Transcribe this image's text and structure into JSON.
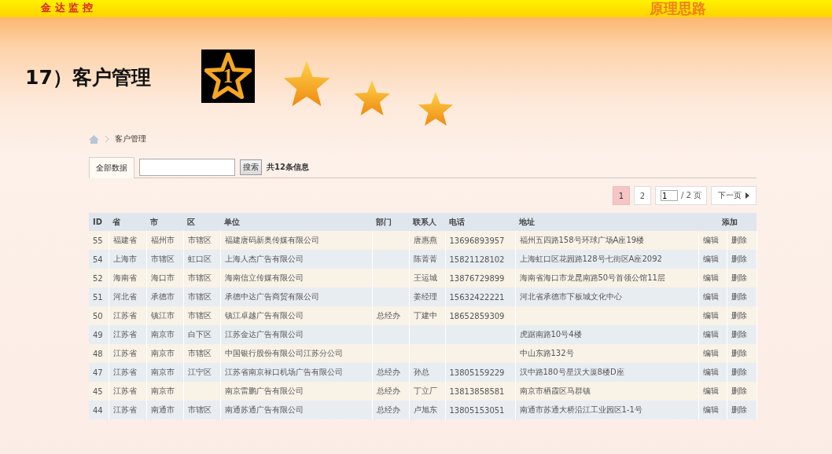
{
  "header": {
    "brand": "金 达 监 控",
    "section": "原理思路"
  },
  "slide_title": "17）客户管理",
  "badge": "1",
  "breadcrumb": "客户管理",
  "tabs": [
    {
      "label": "全部数据",
      "selected": true
    }
  ],
  "search": {
    "button": "搜索"
  },
  "count": "共12条信息",
  "pagination": {
    "pages": [
      {
        "label": "1",
        "selected": true
      },
      {
        "label": "2",
        "selected": false
      }
    ],
    "page_input": "1",
    "total": "/ 2 页",
    "next": "下一页"
  },
  "table": {
    "columns": [
      "ID",
      "省",
      "市",
      "区",
      "单位",
      "部门",
      "联系人",
      "电话",
      "地址",
      "添加"
    ],
    "rows": [
      {
        "cells": [
          "55",
          "福建省",
          "福州市",
          "市辖区",
          "福建唐码新奥传媒有限公司",
          "",
          "唐惠燕",
          "13696893957",
          "福州五四路158号环球广场A座19楼"
        ],
        "actions": [
          "编辑",
          "删除"
        ]
      },
      {
        "cells": [
          "54",
          "上海市",
          "市辖区",
          "虹口区",
          "上海人杰广告有限公司",
          "",
          "陈菁菁",
          "15821128102",
          "上海虹口区花园路128号七街区A座2092"
        ],
        "actions": [
          "编辑",
          "删除"
        ]
      },
      {
        "cells": [
          "52",
          "海南省",
          "海口市",
          "市辖区",
          "海南信立传媒有限公司",
          "",
          "王运城",
          "13876729899",
          "海南省海口市龙昆南路50号首领公馆11层"
        ],
        "actions": [
          "编辑",
          "删除"
        ]
      },
      {
        "cells": [
          "51",
          "河北省",
          "承德市",
          "市辖区",
          "承德中达广告商贸有限公司",
          "",
          "姜经理",
          "15632422221",
          "河北省承德市下板城文化中心"
        ],
        "actions": [
          "编辑",
          "删除"
        ]
      },
      {
        "cells": [
          "50",
          "江苏省",
          "镇江市",
          "市辖区",
          "镇江卓越广告有限公司",
          "总经办",
          "丁建中",
          "18652859309",
          ""
        ],
        "actions": [
          "编辑",
          "删除"
        ]
      },
      {
        "cells": [
          "49",
          "江苏省",
          "南京市",
          "白下区",
          "江苏金达广告有限公司",
          "",
          "",
          "",
          "虎踞南路10号4楼"
        ],
        "actions": [
          "编辑",
          "删除"
        ]
      },
      {
        "cells": [
          "48",
          "江苏省",
          "南京市",
          "市辖区",
          "中国银行股份有限公司江苏分公司",
          "",
          "",
          "",
          "中山东路132号"
        ],
        "actions": [
          "编辑",
          "删除"
        ]
      },
      {
        "cells": [
          "47",
          "江苏省",
          "南京市",
          "江宁区",
          "江苏省南京禄口机场广告有限公司",
          "总经办",
          "孙总",
          "13805159229",
          "汉中路180号星汉大厦8楼D座"
        ],
        "actions": [
          "编辑",
          "删除"
        ]
      },
      {
        "cells": [
          "45",
          "江苏省",
          "南京市",
          "",
          "南京雷鹏广告有限公司",
          "总经办",
          "丁立厂",
          "13813858581",
          "南京市栖霞区马群镇"
        ],
        "actions": [
          "编辑",
          "删除"
        ]
      },
      {
        "cells": [
          "44",
          "江苏省",
          "南通市",
          "市辖区",
          "南通苏通广告有限公司",
          "总经办",
          "卢旭东",
          "13805153051",
          "南通市苏通大桥沿江工业园区1-1号"
        ],
        "actions": [
          "编辑",
          "删除"
        ]
      }
    ]
  }
}
